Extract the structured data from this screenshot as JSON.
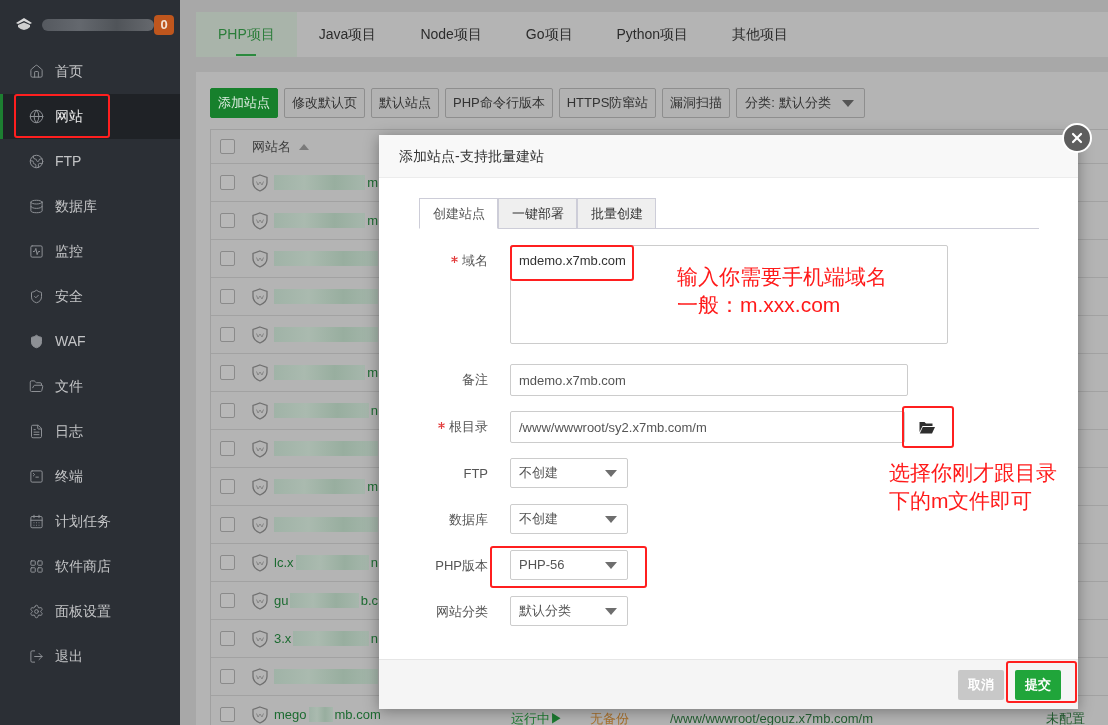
{
  "sidebar": {
    "badge": "0",
    "items": [
      {
        "label": "首页",
        "selected": false,
        "highlighted": false
      },
      {
        "label": "网站",
        "selected": true,
        "highlighted": true
      },
      {
        "label": "FTP",
        "selected": false,
        "highlighted": false
      },
      {
        "label": "数据库",
        "selected": false,
        "highlighted": false
      },
      {
        "label": "监控",
        "selected": false,
        "highlighted": false
      },
      {
        "label": "安全",
        "selected": false,
        "highlighted": false
      },
      {
        "label": "WAF",
        "selected": false,
        "highlighted": false
      },
      {
        "label": "文件",
        "selected": false,
        "highlighted": false
      },
      {
        "label": "日志",
        "selected": false,
        "highlighted": false
      },
      {
        "label": "终端",
        "selected": false,
        "highlighted": false
      },
      {
        "label": "计划任务",
        "selected": false,
        "highlighted": false
      },
      {
        "label": "软件商店",
        "selected": false,
        "highlighted": false
      },
      {
        "label": "面板设置",
        "selected": false,
        "highlighted": false
      },
      {
        "label": "退出",
        "selected": false,
        "highlighted": false
      }
    ]
  },
  "project_tabs": [
    {
      "label": "PHP项目",
      "selected": true
    },
    {
      "label": "Java项目",
      "selected": false
    },
    {
      "label": "Node项目",
      "selected": false
    },
    {
      "label": "Go项目",
      "selected": false
    },
    {
      "label": "Python项目",
      "selected": false
    },
    {
      "label": "其他项目",
      "selected": false
    }
  ],
  "toolbar": {
    "buttons": [
      {
        "label": "添加站点",
        "kind": "primary"
      },
      {
        "label": "修改默认页",
        "kind": "default"
      },
      {
        "label": "默认站点",
        "kind": "default"
      },
      {
        "label": "PHP命令行版本",
        "kind": "default"
      },
      {
        "label": "HTTPS防窜站",
        "kind": "default"
      },
      {
        "label": "漏洞扫描",
        "kind": "default"
      }
    ],
    "category_select": {
      "value": "分类: 默认分类"
    }
  },
  "table": {
    "select_all": {
      "checked": false
    },
    "columns": [
      {
        "label": "网站名",
        "sorted_ascending": true
      }
    ],
    "rows": [
      {
        "checked": false,
        "name_end": "m"
      },
      {
        "checked": false,
        "name_end": "m"
      },
      {
        "checked": false
      },
      {
        "checked": false
      },
      {
        "checked": false
      },
      {
        "checked": false,
        "name_end": "m"
      },
      {
        "checked": false,
        "name_end": "n"
      },
      {
        "checked": false
      },
      {
        "checked": false,
        "name_end": "m"
      },
      {
        "checked": false
      },
      {
        "checked": false,
        "name_start": "lc.x",
        "name_end": "n"
      },
      {
        "checked": false,
        "name_start": "gu",
        "name_end": "b.c"
      },
      {
        "checked": false,
        "name_start": "3.x",
        "name_end": "n"
      },
      {
        "checked": false
      },
      {
        "checked": false,
        "name_start": "mego",
        "name_end": "mb.com",
        "status": "运行中▶",
        "backup": "无备份",
        "path": "/www/wwwroot/egouz.x7mb.com/m",
        "column_6": "未配置"
      }
    ]
  },
  "dialog": {
    "title": "添加站点-支持批量建站",
    "tabs": [
      {
        "label": "创建站点",
        "selected": true
      },
      {
        "label": "一键部署",
        "selected": false
      },
      {
        "label": "批量创建",
        "selected": false
      }
    ],
    "fields": [
      {
        "kind": "textarea",
        "label": "域名",
        "required": true,
        "value": "mdemo.x7mb.com",
        "highlighted": true,
        "note": [
          "输入你需要手机端域名",
          "一般：m.xxx.com"
        ]
      },
      {
        "kind": "input",
        "label": "备注",
        "required": false,
        "value": "mdemo.x7mb.com",
        "highlighted": false
      },
      {
        "kind": "path",
        "label": "根目录",
        "required": true,
        "value": "/www/wwwroot/sy2.x7mb.com/m",
        "highlighted": true,
        "note": [
          "选择你刚才跟目录",
          "下的m文件即可"
        ]
      },
      {
        "kind": "select",
        "label": "FTP",
        "required": false,
        "value": "不创建",
        "highlighted": false
      },
      {
        "kind": "select",
        "label": "数据库",
        "required": false,
        "value": "不创建",
        "highlighted": false
      },
      {
        "kind": "select",
        "label": "PHP版本",
        "required": false,
        "value": "PHP-56",
        "highlighted": true
      },
      {
        "kind": "select",
        "label": "网站分类",
        "required": false,
        "value": "默认分类",
        "highlighted": false
      }
    ],
    "buttons": [
      {
        "label": "取消",
        "kind": "cancel",
        "highlighted": false
      },
      {
        "label": "提交",
        "kind": "submit",
        "highlighted": true
      }
    ]
  }
}
